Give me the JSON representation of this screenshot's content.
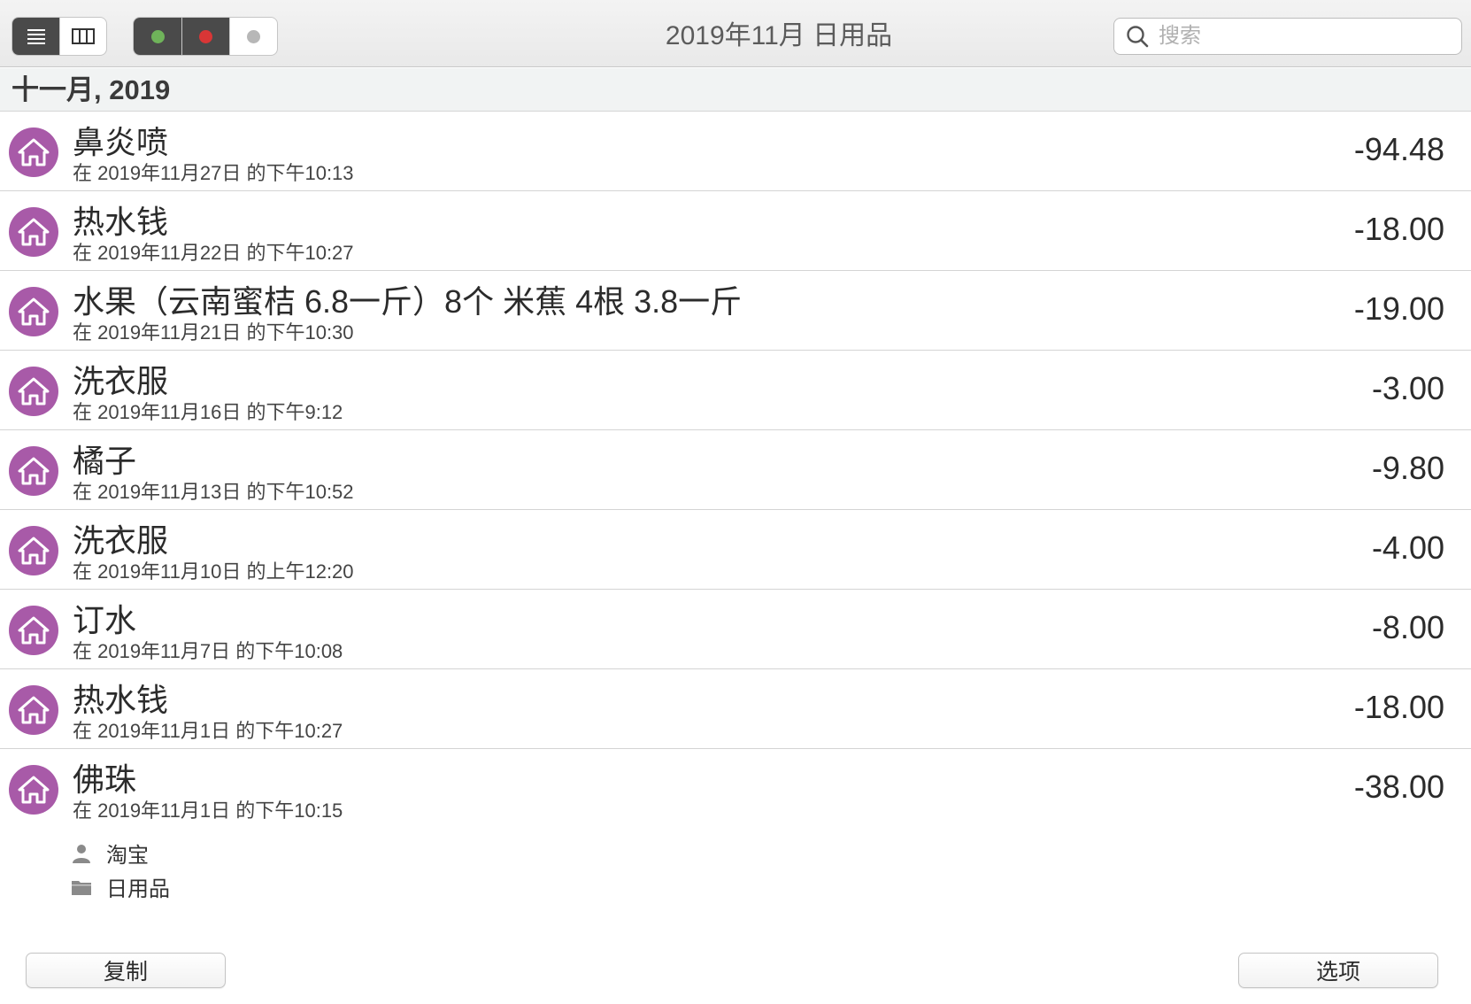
{
  "toolbar": {
    "title": "2019年11月 日用品",
    "view_buttons": [
      {
        "icon": "list-view-icon",
        "active": true
      },
      {
        "icon": "columns-view-icon",
        "active": false
      }
    ],
    "filter_buttons": [
      {
        "icon": "green-dot-icon",
        "color": "#6fb35a",
        "active": true
      },
      {
        "icon": "red-dot-icon",
        "color": "#d93636",
        "active": true
      },
      {
        "icon": "gray-dot-icon",
        "color": "#b7b7b7",
        "active": false
      }
    ],
    "search": {
      "placeholder": "搜索",
      "value": ""
    }
  },
  "section": {
    "title": "十一月, 2019"
  },
  "colors": {
    "category_avatar": "#a85aa8",
    "toolbar_active": "#4a4a4a"
  },
  "transactions": [
    {
      "title": "鼻炎喷",
      "subtitle": "在 2019年11月27日 的下午10:13",
      "amount": "-94.48",
      "icon": "home-icon"
    },
    {
      "title": "热水钱",
      "subtitle": "在 2019年11月22日 的下午10:27",
      "amount": "-18.00",
      "icon": "home-icon"
    },
    {
      "title": "水果（云南蜜桔 6.8一斤）8个 米蕉 4根 3.8一斤",
      "subtitle": "在 2019年11月21日 的下午10:30",
      "amount": "-19.00",
      "icon": "home-icon"
    },
    {
      "title": "洗衣服",
      "subtitle": "在 2019年11月16日 的下午9:12",
      "amount": "-3.00",
      "icon": "home-icon"
    },
    {
      "title": "橘子",
      "subtitle": "在 2019年11月13日 的下午10:52",
      "amount": "-9.80",
      "icon": "home-icon"
    },
    {
      "title": "洗衣服",
      "subtitle": "在 2019年11月10日 的上午12:20",
      "amount": "-4.00",
      "icon": "home-icon"
    },
    {
      "title": "订水",
      "subtitle": "在 2019年11月7日 的下午10:08",
      "amount": "-8.00",
      "icon": "home-icon"
    },
    {
      "title": "热水钱",
      "subtitle": "在 2019年11月1日 的下午10:27",
      "amount": "-18.00",
      "icon": "home-icon"
    },
    {
      "title": "佛珠",
      "subtitle": "在 2019年11月1日 的下午10:15",
      "amount": "-38.00",
      "icon": "home-icon"
    }
  ],
  "details": {
    "payee": {
      "icon": "person-icon",
      "label": "淘宝"
    },
    "category": {
      "icon": "folder-icon",
      "label": "日用品"
    }
  },
  "buttons": {
    "copy": "复制",
    "options": "选项"
  }
}
